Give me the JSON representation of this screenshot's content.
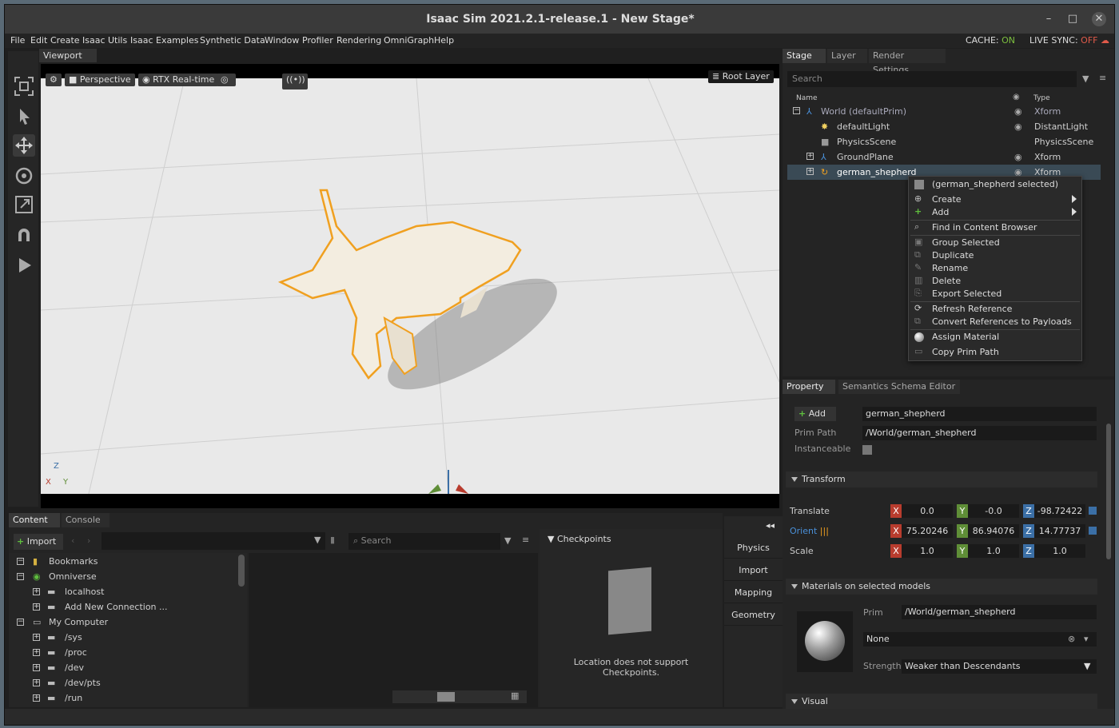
{
  "window": {
    "title": "Isaac Sim 2021.2.1-release.1 - New Stage*"
  },
  "menu": {
    "items": [
      "File",
      "Edit",
      "Create",
      "Isaac Utils",
      "Isaac Examples",
      "Synthetic Data",
      "Window",
      "Profiler",
      "Rendering",
      "OmniGraph",
      "Help"
    ],
    "cache_label": "CACHE:",
    "cache_value": "ON",
    "sync_label": "LIVE SYNC:",
    "sync_value": "OFF"
  },
  "viewport": {
    "tab": "Viewport",
    "camera": "Perspective",
    "renderer": "RTX Real-time",
    "layer": "Root Layer",
    "axis_z": "Z",
    "axis_x": "X",
    "axis_y": "Y"
  },
  "stage": {
    "tabs": [
      "Stage",
      "Layer",
      "Render Settings"
    ],
    "search_placeholder": "Search",
    "col_name": "Name",
    "col_type": "Type",
    "rows": [
      {
        "name": "World (defaultPrim)",
        "type": "Xform"
      },
      {
        "name": "defaultLight",
        "type": "DistantLight"
      },
      {
        "name": "PhysicsScene",
        "type": "PhysicsScene"
      },
      {
        "name": "GroundPlane",
        "type": "Xform"
      },
      {
        "name": "german_shepherd",
        "type": "Xform"
      }
    ]
  },
  "context_menu": {
    "header": "(german_shepherd selected)",
    "items": [
      "Create",
      "Add",
      "Find in Content Browser",
      "Group Selected",
      "Duplicate",
      "Rename",
      "Delete",
      "Export Selected",
      "Refresh Reference",
      "Convert References to Payloads",
      "Assign Material",
      "Copy Prim Path"
    ]
  },
  "property": {
    "tabs": [
      "Property",
      "Semantics Schema Editor"
    ],
    "add_label": "Add",
    "name_value": "german_shepherd",
    "prim_path_label": "Prim Path",
    "prim_path_value": "/World/german_shepherd",
    "instanceable_label": "Instanceable",
    "transform_label": "Transform",
    "translate_label": "Translate",
    "orient_label": "Orient",
    "scale_label": "Scale",
    "translate": [
      "0.0",
      "-0.0",
      "-98.72422"
    ],
    "orient": [
      "75.20246",
      "86.94076",
      "14.77737"
    ],
    "scale": [
      "1.0",
      "1.0",
      "1.0"
    ],
    "ax": [
      "X",
      "Y",
      "Z"
    ],
    "materials_label": "Materials on selected models",
    "prim_label": "Prim",
    "prim_value": "/World/german_shepherd",
    "material_value": "None",
    "strength_label": "Strength",
    "strength_value": "Weaker than Descendants",
    "visual_label": "Visual"
  },
  "content": {
    "tabs": [
      "Content",
      "Console"
    ],
    "import_label": "Import",
    "search_placeholder": "Search",
    "tree": [
      {
        "label": "Bookmarks"
      },
      {
        "label": "Omniverse"
      },
      {
        "label": "localhost"
      },
      {
        "label": "Add New Connection ..."
      },
      {
        "label": "My Computer"
      },
      {
        "label": "/sys"
      },
      {
        "label": "/proc"
      },
      {
        "label": "/dev"
      },
      {
        "label": "/dev/pts"
      },
      {
        "label": "/run"
      }
    ],
    "checkpoints_label": "Checkpoints",
    "checkpoints_msg1": "Location does not support",
    "checkpoints_msg2": "Checkpoints."
  },
  "sidebar": {
    "buttons": [
      "Physics",
      "Import",
      "Mapping",
      "Geometry"
    ]
  }
}
